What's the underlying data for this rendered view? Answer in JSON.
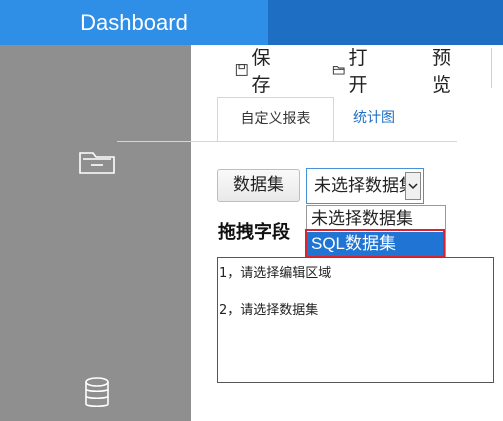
{
  "header": {
    "brand": "Dashboard"
  },
  "sidebar": {
    "items": [
      {
        "icon": "folder-open-icon"
      },
      {
        "icon": "database-icon"
      }
    ]
  },
  "toolbar": {
    "save_label": "保存",
    "open_label": "打开",
    "preview_label": "预览"
  },
  "tabs": [
    {
      "label": "自定义报表",
      "active": true
    },
    {
      "label": "统计图",
      "active": false
    }
  ],
  "dataset": {
    "button_label": "数据集",
    "select_value": "未选择数据集",
    "options": [
      "未选择数据集",
      "SQL数据集"
    ],
    "highlighted_option": "SQL数据集"
  },
  "fields": {
    "title": "拖拽字段"
  },
  "instructions": [
    "1，请选择编辑区域",
    "2，请选择数据集"
  ],
  "colors": {
    "topbar": "#1e6fc4",
    "brand_bg": "#2f8fe6",
    "sidebar": "#8f8f8f",
    "accent": "#1f74d4",
    "highlight_border": "#d9262e"
  }
}
